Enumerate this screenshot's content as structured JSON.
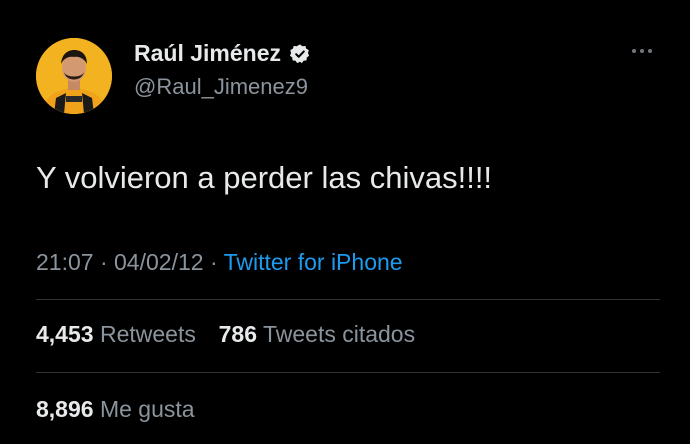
{
  "author": {
    "display_name": "Raúl Jiménez",
    "handle": "@Raul_Jimenez9",
    "verified": true
  },
  "tweet": {
    "text": "Y volvieron a perder las chivas!!!!",
    "time": "21:07",
    "separator": "·",
    "date": "04/02/12",
    "source": "Twitter for iPhone"
  },
  "stats": {
    "retweets_count": "4,453",
    "retweets_label": "Retweets",
    "quotes_count": "786",
    "quotes_label": "Tweets citados",
    "likes_count": "8,896",
    "likes_label": "Me gusta"
  },
  "colors": {
    "background": "#000000",
    "text_primary": "#e7e9ea",
    "text_secondary": "#8b949c",
    "link": "#1d9bf0",
    "divider": "#2f3336",
    "verified_badge": "#e7e9ea"
  },
  "icons": {
    "verified": "verified-badge-icon",
    "more": "more-dots-icon"
  }
}
